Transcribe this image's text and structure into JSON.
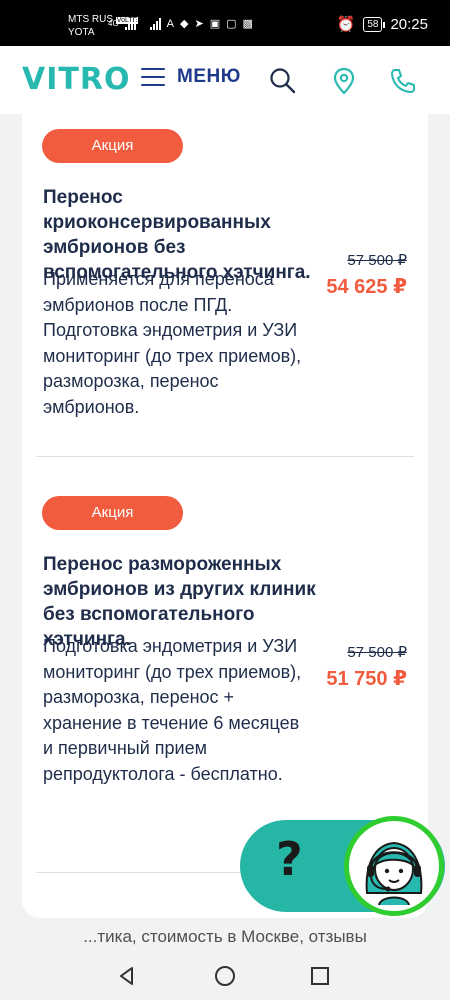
{
  "status_bar": {
    "carrier1": "MTS RUS",
    "carrier1_tag": "VoLTE",
    "carrier2": "YOTA",
    "network": "4G",
    "battery": "58",
    "time": "20:25"
  },
  "header": {
    "logo": "VITRO",
    "menu_label": "МЕНЮ",
    "icons": [
      "search-icon",
      "location-pin-icon",
      "phone-icon"
    ],
    "accent_color": "#27b9b0",
    "brand_blue": "#1f3a8a"
  },
  "services": [
    {
      "badge": "Акция",
      "title": "Перенос криоконсервированных эмбрионов без вспомогательного хэтчинга.",
      "description": "Применяется для переноса эмбрионов после ПГД. Подготовка эндометрия и УЗИ мониторинг (до трех приемов), разморозка, перенос эмбрионов.",
      "old_price": "57 500 ₽",
      "new_price": "54 625 ₽"
    },
    {
      "badge": "Акция",
      "title": "Перенос размороженных эмбрионов из других клиник без вспомогательного хэтчинга.",
      "description": "Подготовка эндометрия и УЗИ мониторинг (до трех приемов), разморозка, перенос + хранение в течение 6 месяцев и первичный прием репродуктолога - бесплатно.",
      "old_price": "57 500 ₽",
      "new_price": "51 750 ₽"
    }
  ],
  "chat_widget": {
    "symbol": "?",
    "color": "#26b6a6",
    "border_color": "#2fcd2f"
  },
  "url_footer": "...тика, стоимость в Москве, отзывы",
  "badge_color": "#f25c3e"
}
